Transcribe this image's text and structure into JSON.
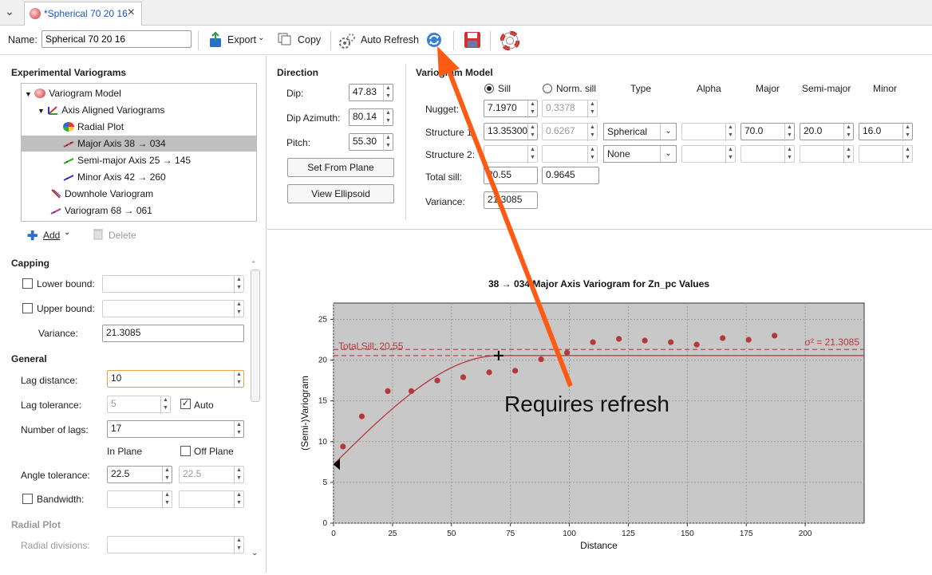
{
  "tab": {
    "title": "*Spherical 70 20 16",
    "close": "×"
  },
  "toolbar": {
    "name_label": "Name:",
    "name_value": "Spherical 70 20 16",
    "export_label": "Export",
    "copy_label": "Copy",
    "auto_refresh_label": "Auto Refresh"
  },
  "left": {
    "experimental_title": "Experimental Variograms",
    "tree": [
      {
        "label": "Variogram Model"
      },
      {
        "label": "Axis Aligned Variograms"
      },
      {
        "label": "Radial Plot"
      },
      {
        "label": "Major Axis 38 → 034"
      },
      {
        "label": "Semi-major Axis 25 → 145"
      },
      {
        "label": "Minor Axis 42 → 260"
      },
      {
        "label": "Downhole Variogram"
      },
      {
        "label": "Variogram 68 → 061"
      }
    ],
    "add_label": "Add",
    "delete_label": "Delete",
    "capping": {
      "title": "Capping",
      "lower_label": "Lower bound:",
      "upper_label": "Upper bound:",
      "variance_label": "Variance:",
      "variance_value": "21.3085"
    },
    "general": {
      "title": "General",
      "lag_distance_label": "Lag distance:",
      "lag_distance_value": "10",
      "lag_tolerance_label": "Lag tolerance:",
      "lag_tolerance_value": "5",
      "auto_label": "Auto",
      "number_of_lags_label": "Number of lags:",
      "number_of_lags_value": "17",
      "in_plane_label": "In Plane",
      "off_plane_label": "Off Plane",
      "angle_tolerance_label": "Angle tolerance:",
      "angle_tolerance_value": "22.5",
      "angle_tolerance_off_value": "22.5",
      "bandwidth_label": "Bandwidth:"
    },
    "radial": {
      "title": "Radial Plot",
      "divisions_label": "Radial divisions:"
    }
  },
  "direction": {
    "title": "Direction",
    "dip_label": "Dip:",
    "dip_value": "47.83",
    "dip_az_label": "Dip Azimuth:",
    "dip_az_value": "80.14",
    "pitch_label": "Pitch:",
    "pitch_value": "55.30",
    "set_from_plane": "Set From Plane",
    "view_ellipsoid": "View Ellipsoid"
  },
  "model": {
    "title": "Variogram Model",
    "sill_label": "Sill",
    "norm_sill_label": "Norm. sill",
    "col_type": "Type",
    "col_alpha": "Alpha",
    "col_major": "Major",
    "col_semimajor": "Semi-major",
    "col_minor": "Minor",
    "nugget_label": "Nugget:",
    "nugget_value": "7.1970",
    "nugget_norm": "0.3378",
    "s1_label": "Structure 1:",
    "s1_value": "13.353000",
    "s1_norm": "0.6267",
    "s1_type": "Spherical",
    "s1_major": "70.0",
    "s1_semimajor": "20.0",
    "s1_minor": "16.0",
    "s2_label": "Structure 2:",
    "s2_type": "None",
    "total_sill_label": "Total sill:",
    "total_sill_value": "20.55",
    "total_sill_norm": "0.9645",
    "variance_label": "Variance:",
    "variance_value": "21.3085"
  },
  "annotation": {
    "text": "Requires refresh",
    "color": "#ff5a14"
  },
  "chart_data": {
    "type": "scatter",
    "title": "38 → 034 Major Axis Variogram for Zn_pc Values",
    "xlabel": "Distance",
    "ylabel": "(Semi-)Variogram",
    "xlim": [
      0,
      225
    ],
    "ylim": [
      0,
      27
    ],
    "xticks": [
      0,
      25,
      50,
      75,
      100,
      125,
      150,
      175,
      200
    ],
    "yticks": [
      0,
      5,
      10,
      15,
      20,
      25
    ],
    "grid": true,
    "background": "#c8c8c8",
    "points": {
      "x": [
        4,
        12,
        23,
        33,
        44,
        55,
        66,
        77,
        88,
        99,
        110,
        121,
        132,
        143,
        154,
        165,
        176,
        187
      ],
      "y": [
        9.4,
        13.1,
        16.2,
        16.2,
        17.5,
        17.9,
        18.5,
        18.7,
        20.1,
        20.9,
        22.2,
        22.6,
        22.4,
        22.2,
        21.9,
        22.7,
        22.5,
        23.0
      ]
    },
    "model": {
      "nugget": 7.197,
      "sill": 20.55,
      "range": 70
    },
    "total_sill_label": "Total Sill: 20.55",
    "variance_label": "σ² = 21.3085",
    "variance": 21.3085,
    "point_color": "#b5383c",
    "line_color": "#b5383c"
  }
}
